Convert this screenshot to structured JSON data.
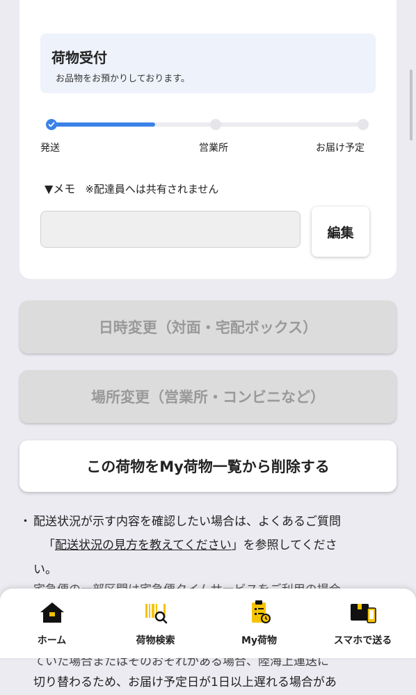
{
  "status": {
    "title": "荷物受付",
    "description": "お品物をお預かりしております。"
  },
  "progress": {
    "fraction": 0.33,
    "steps": [
      "発送",
      "営業所",
      "お届け予定"
    ],
    "active_color": "#3b82e8"
  },
  "memo": {
    "label": "▼メモ",
    "note": "※配達員へは共有されません",
    "value": "",
    "edit_label": "編集"
  },
  "actions": {
    "change_datetime": "日時変更（対面・宅配ボックス）",
    "change_location": "場所変更（営業所・コンビニなど）",
    "delete": "この荷物をMy荷物一覧から削除する"
  },
  "notes": {
    "bullet": "・",
    "line1": "配送状況が示す内容を確認したい場合は、よくあるご質問",
    "line2_open": "「",
    "line2_link": "配送状況の見方を教えてください",
    "line2_close": "」を参照してくださ",
    "line3": "い。",
    "line4_partial": "宅急便の一部区間は宅急便タイムサービスをご利用の場合",
    "line5_partial": "ていた場合またはそのおそれがある場合、陸海上運送に",
    "line6": "切り替わるため、お届け予定日が1日以上遅れる場合があ"
  },
  "nav": {
    "items": [
      {
        "label": "ホーム",
        "icon": "home-icon"
      },
      {
        "label": "荷物検索",
        "icon": "barcode-search-icon"
      },
      {
        "label": "My荷物",
        "icon": "clipboard-icon"
      },
      {
        "label": "スマホで送る",
        "icon": "package-phone-icon"
      }
    ],
    "accent": "#f5c400"
  }
}
